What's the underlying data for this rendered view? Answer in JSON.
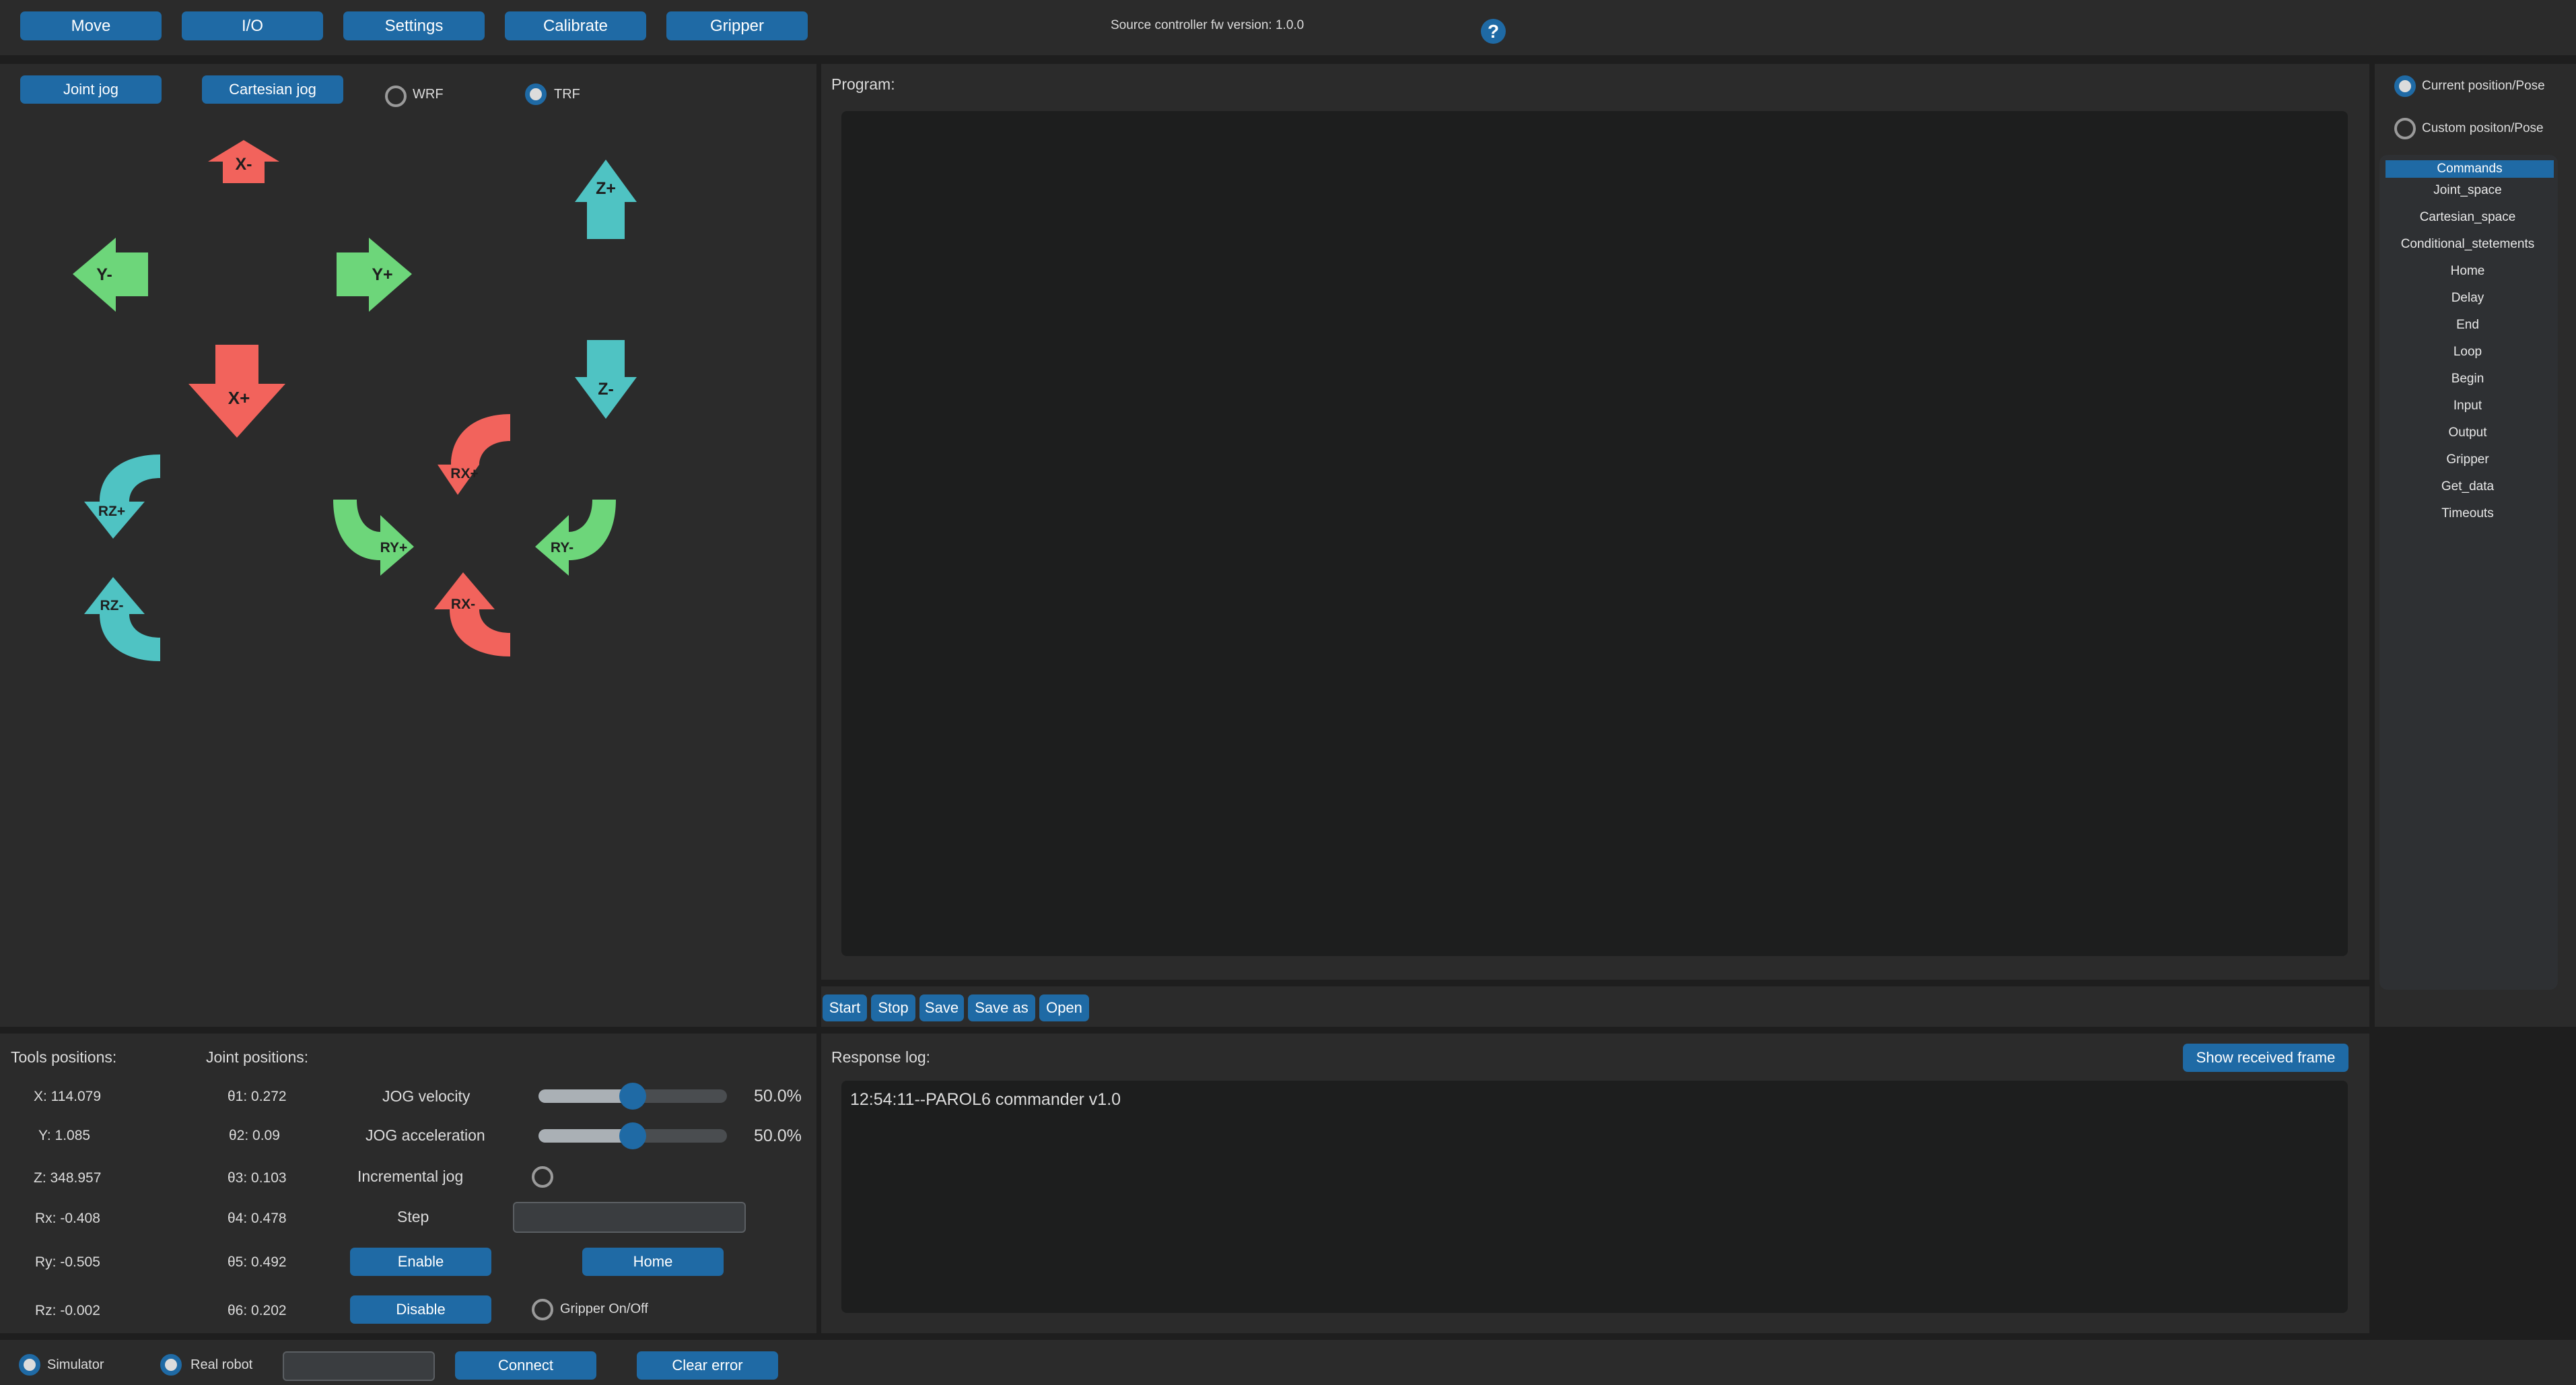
{
  "topbar": {
    "tabs": [
      "Move",
      "I/O",
      "Settings",
      "Calibrate",
      "Gripper"
    ],
    "fw_version": "Source controller fw version: 1.0.0",
    "help_label": "?"
  },
  "jog": {
    "joint_jog": "Joint jog",
    "cartesian_jog": "Cartesian jog",
    "wrf": "WRF",
    "trf": "TRF",
    "selected_frame": "TRF",
    "arrows": {
      "x_minus": "X-",
      "x_plus": "X+",
      "y_minus": "Y-",
      "y_plus": "Y+",
      "z_plus": "Z+",
      "z_minus": "Z-",
      "rx_plus": "RX+",
      "rx_minus": "RX-",
      "ry_plus": "RY+",
      "ry_minus": "RY-",
      "rz_plus": "RZ+",
      "rz_minus": "RZ-"
    },
    "colors": {
      "x": "#f2635c",
      "y": "#6dd67a",
      "z": "#4fc3c3"
    }
  },
  "program": {
    "title": "Program:",
    "buttons": [
      "Start",
      "Stop",
      "Save",
      "Save as",
      "Open"
    ]
  },
  "right": {
    "current_pose": "Current position/Pose",
    "custom_pose": "Custom positon/Pose",
    "commands_header": "Commands",
    "commands": [
      "Joint_space",
      "Cartesian_space",
      "Conditional_stetements",
      "Home",
      "Delay",
      "End",
      "Loop",
      "Begin",
      "Input",
      "Output",
      "Gripper",
      "Get_data",
      "Timeouts"
    ]
  },
  "positions": {
    "tools_title": "Tools positions:",
    "joints_title": "Joint positions:",
    "tools": [
      "X: 114.079",
      "Y:  1.085",
      "Z: 348.957",
      "Rx: -0.408",
      "Ry: -0.505",
      "Rz: -0.002"
    ],
    "joints": [
      "θ1:  0.272",
      "θ2:  0.09",
      "θ3:  0.103",
      "θ4:  0.478",
      "θ5:  0.492",
      "θ6:  0.202"
    ]
  },
  "controls": {
    "jog_velocity_label": "JOG velocity",
    "jog_velocity_value": "50.0%",
    "jog_velocity_fraction": 0.5,
    "jog_accel_label": "JOG acceleration",
    "jog_accel_value": "50.0%",
    "jog_accel_fraction": 0.5,
    "incremental_label": "Incremental jog",
    "step_label": "Step",
    "step_value": "",
    "enable": "Enable",
    "disable": "Disable",
    "home": "Home",
    "gripper_toggle": "Gripper On/Off"
  },
  "log": {
    "title": "Response log:",
    "show_frame": "Show received frame",
    "lines": [
      "12:54:11--PAROL6 commander v1.0"
    ]
  },
  "bottom": {
    "simulator": "Simulator",
    "real_robot": "Real robot",
    "port_value": "",
    "connect": "Connect",
    "clear_error": "Clear error"
  }
}
